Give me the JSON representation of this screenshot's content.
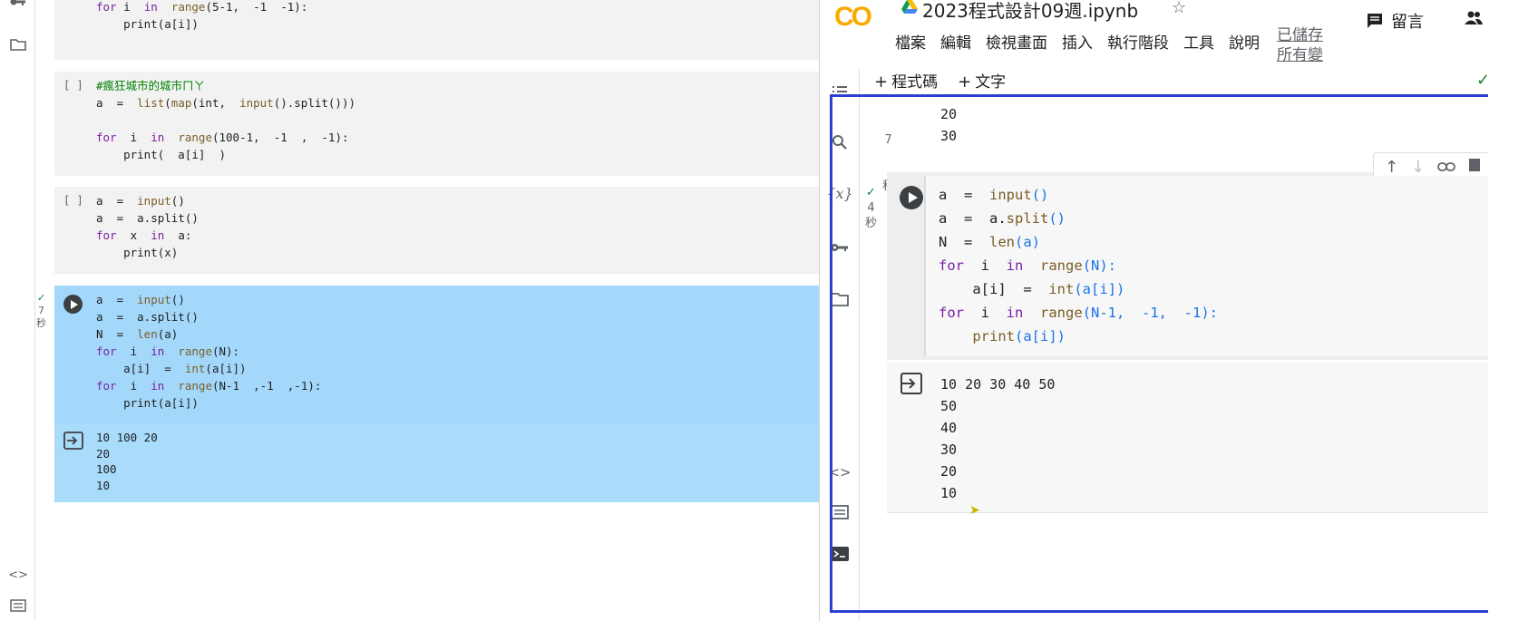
{
  "left": {
    "top_cell_lines": [
      [
        {
          "t": "for",
          "c": "kw"
        },
        {
          "t": " i  "
        },
        {
          "t": "in",
          "c": "kw"
        },
        {
          "t": "  "
        },
        {
          "t": "range",
          "c": "fn"
        },
        {
          "t": "(5-1,  -1  -1):"
        }
      ],
      [
        {
          "t": "    print(a[i])"
        }
      ]
    ],
    "cell2_bracket": "[ ]",
    "cell2_lines": [
      [
        {
          "t": "#瘋狂城市的城市ㄇㄚ",
          "c": "cm"
        }
      ],
      [
        {
          "t": "a  =  "
        },
        {
          "t": "list",
          "c": "fn"
        },
        {
          "t": "("
        },
        {
          "t": "map",
          "c": "fn"
        },
        {
          "t": "(int,  "
        },
        {
          "t": "input",
          "c": "fn"
        },
        {
          "t": "().split()))"
        }
      ],
      [
        {
          "t": ""
        }
      ],
      [
        {
          "t": "for",
          "c": "kw"
        },
        {
          "t": "  i  "
        },
        {
          "t": "in",
          "c": "kw"
        },
        {
          "t": "  "
        },
        {
          "t": "range",
          "c": "fn"
        },
        {
          "t": "(100-1,  -1  ,  -1):"
        }
      ],
      [
        {
          "t": "    print(  a[i]  )"
        }
      ]
    ],
    "cell3_bracket": "[ ]",
    "cell3_lines": [
      [
        {
          "t": "a  =  "
        },
        {
          "t": "input",
          "c": "fn"
        },
        {
          "t": "()"
        }
      ],
      [
        {
          "t": "a  =  a.split()"
        }
      ],
      [
        {
          "t": "for",
          "c": "kw"
        },
        {
          "t": "  x  "
        },
        {
          "t": "in",
          "c": "kw"
        },
        {
          "t": "  a:"
        }
      ],
      [
        {
          "t": "    print(x)"
        }
      ]
    ],
    "cell4_meta": [
      "✓",
      "7",
      "秒"
    ],
    "cell4_lines": [
      [
        {
          "t": "a  =  "
        },
        {
          "t": "input",
          "c": "fn"
        },
        {
          "t": "()"
        }
      ],
      [
        {
          "t": "a  =  a.split()"
        }
      ],
      [
        {
          "t": "N  =  "
        },
        {
          "t": "len",
          "c": "fn"
        },
        {
          "t": "(a)"
        }
      ],
      [
        {
          "t": "for",
          "c": "kw"
        },
        {
          "t": "  i  "
        },
        {
          "t": "in",
          "c": "kw"
        },
        {
          "t": "  "
        },
        {
          "t": "range",
          "c": "fn"
        },
        {
          "t": "(N):"
        }
      ],
      [
        {
          "t": "    a[i]  =  "
        },
        {
          "t": "int",
          "c": "fn"
        },
        {
          "t": "(a[i])"
        }
      ],
      [
        {
          "t": "for",
          "c": "kw"
        },
        {
          "t": "  i  "
        },
        {
          "t": "in",
          "c": "kw"
        },
        {
          "t": "  "
        },
        {
          "t": "range",
          "c": "fn"
        },
        {
          "t": "(N-1  ,-1  ,-1):"
        }
      ],
      [
        {
          "t": "    print(a[i])"
        }
      ]
    ],
    "cell4_output": [
      "10 100 20",
      "20",
      "100",
      "10"
    ]
  },
  "right": {
    "logo": "CO",
    "title": "2023程式設計09週.ipynb",
    "menu": [
      "檔案",
      "編輯",
      "檢視畫面",
      "插入",
      "執行階段",
      "工具",
      "說明"
    ],
    "saved_status": "已儲存所有變",
    "comment_label": "留言",
    "toolbar": {
      "add_code": "程式碼",
      "add_text": "文字"
    },
    "prev_meta": [
      "7",
      "秒"
    ],
    "prev_output": [
      "20",
      "30"
    ],
    "exec_meta": [
      "✓",
      "4",
      "秒"
    ],
    "code_lines": [
      [
        {
          "t": "a  =  "
        },
        {
          "t": "input",
          "c": "cf"
        },
        {
          "t": "()",
          "c": "cp"
        }
      ],
      [
        {
          "t": "a  =  a."
        },
        {
          "t": "split",
          "c": "cf"
        },
        {
          "t": "()",
          "c": "cp"
        }
      ],
      [
        {
          "t": "N  =  "
        },
        {
          "t": "len",
          "c": "cf"
        },
        {
          "t": "(a)",
          "c": "cp"
        }
      ],
      [
        {
          "t": "for",
          "c": "ck"
        },
        {
          "t": "  i  "
        },
        {
          "t": "in",
          "c": "ck"
        },
        {
          "t": "  "
        },
        {
          "t": "range",
          "c": "cf"
        },
        {
          "t": "(N):",
          "c": "cp"
        }
      ],
      [
        {
          "t": "    a[i]  =  "
        },
        {
          "t": "int",
          "c": "cf"
        },
        {
          "t": "(a[i])",
          "c": "cp"
        }
      ],
      [
        {
          "t": "for",
          "c": "ck"
        },
        {
          "t": "  i  "
        },
        {
          "t": "in",
          "c": "ck"
        },
        {
          "t": "  "
        },
        {
          "t": "range",
          "c": "cf"
        },
        {
          "t": "(N-1,  -1,  -1):",
          "c": "cp"
        }
      ],
      [
        {
          "t": "    print",
          "c": "cf"
        },
        {
          "t": "(a[i])",
          "c": "cp"
        }
      ]
    ],
    "output_lines": [
      "10 20 30 40 50",
      "50",
      "40",
      "30",
      "20",
      "10"
    ]
  }
}
